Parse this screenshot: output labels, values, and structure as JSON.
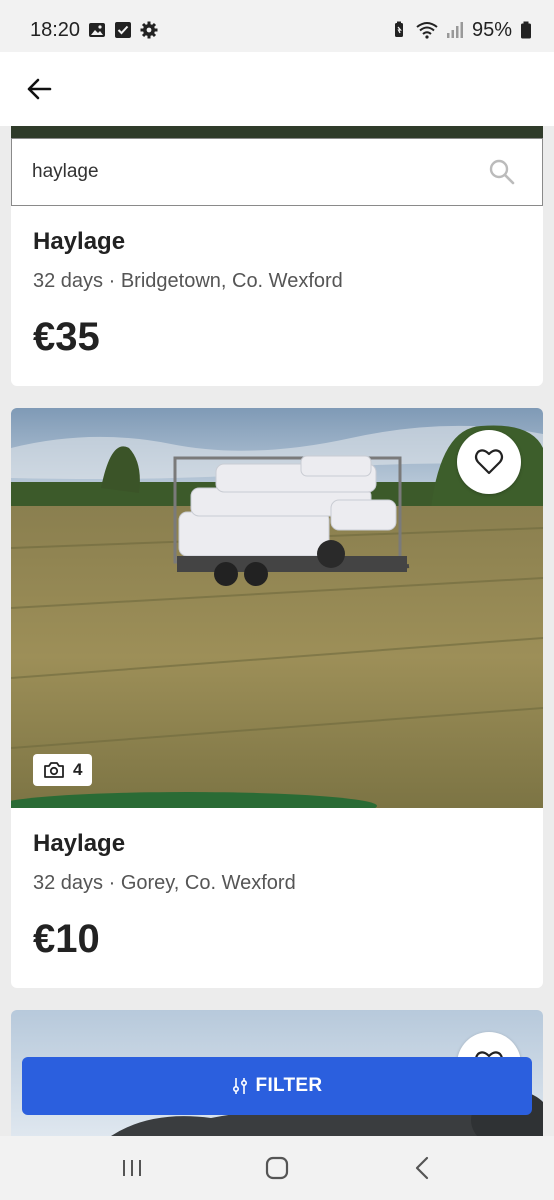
{
  "status_bar": {
    "time": "18:20",
    "battery": "95%",
    "icons": [
      "gallery-icon",
      "check-icon",
      "gear-icon",
      "battery-saver-icon",
      "wifi-icon",
      "signal-icon",
      "battery-icon"
    ]
  },
  "header": {
    "back_icon": "arrow-left-icon"
  },
  "search": {
    "value": "haylage",
    "icon": "search-icon"
  },
  "listings": [
    {
      "title": "Haylage",
      "meta": "32 days · Bridgetown, Co. Wexford",
      "price": "€35"
    },
    {
      "title": "Haylage",
      "meta": "32 days · Gorey, Co. Wexford",
      "price": "€10",
      "photo_count": "4",
      "photo_description_icon": "camera-icon",
      "favourite_icon": "heart-icon"
    },
    {
      "favourite_icon": "heart-icon"
    }
  ],
  "filter": {
    "label": "FILTER",
    "icon": "sliders-icon"
  },
  "nav": {
    "recents_icon": "recents-icon",
    "home_icon": "home-icon",
    "back_icon": "nav-back-icon"
  },
  "colors": {
    "accent": "#2b5fde",
    "background": "#ececec",
    "card": "#ffffff"
  }
}
